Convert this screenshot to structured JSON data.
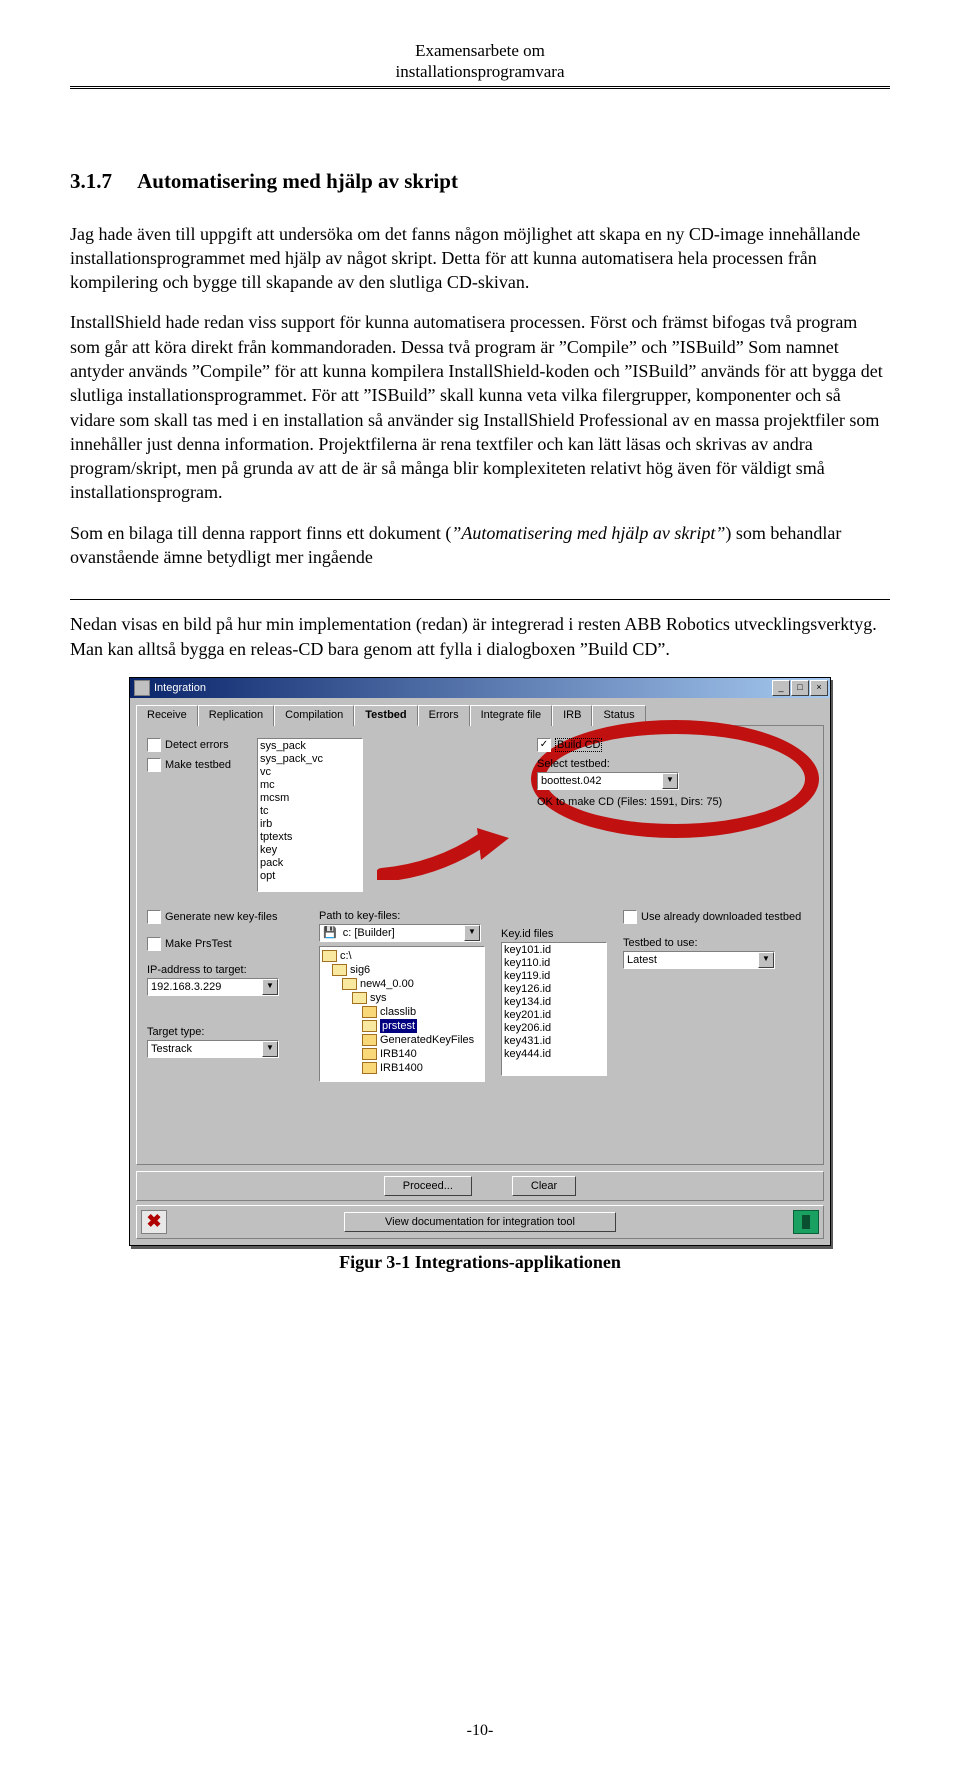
{
  "header": {
    "line1": "Examensarbete om",
    "line2": "installationsprogramvara"
  },
  "section": {
    "number": "3.1.7",
    "title": "Automatisering med hjälp av skript"
  },
  "para1": "Jag hade även till uppgift att undersöka om det fanns någon möjlighet att skapa en ny CD-image innehållande installationsprogrammet med hjälp av något skript. Detta för att kunna automatisera hela processen från kompilering och bygge till skapande av den slutliga CD-skivan.",
  "para2": "InstallShield hade redan viss support för kunna automatisera processen. Först och främst bifogas två program som går att köra direkt från kommandoraden. Dessa två program är ”Compile” och ”ISBuild” Som namnet antyder används ”Compile” för att kunna kompilera InstallShield-koden och ”ISBuild” används för att bygga det slutliga installationsprogrammet. För att ”ISBuild” skall kunna veta vilka filergrupper, komponenter och så vidare som skall tas med i en installation så använder sig InstallShield Professional av en massa projektfiler som innehåller just denna information. Projektfilerna är rena textfiler och kan lätt läsas och skrivas av andra program/skript, men på grunda av att de är så många blir komplexiteten relativt hög även för väldigt små installationsprogram.",
  "para3a": "Som en bilaga till denna rapport finns ett dokument (",
  "para3i": "”Automatisering med hjälp av skript”",
  "para3b": ") som behandlar ovanstående ämne betydligt mer ingående",
  "para4": "Nedan visas en bild på hur min implementation (redan) är integrerad i resten ABB Robotics utvecklingsverktyg. Man kan alltså bygga en releas-CD bara genom att fylla i dialogboxen ”Build CD”.",
  "figure_caption": "Figur 3-1 Integrations-applikationen",
  "page_number": "-10-",
  "win": {
    "title": "Integration",
    "tabs": [
      "Receive",
      "Replication",
      "Compilation",
      "Testbed",
      "Errors",
      "Integrate file",
      "IRB",
      "Status"
    ],
    "active_tab": "Testbed",
    "cb_detect": "Detect errors",
    "cb_make_testbed": "Make testbed",
    "list_left": [
      "sys_pack",
      "sys_pack_vc",
      "vc",
      "mc",
      "mcsm",
      "tc",
      "irb",
      "tptexts",
      "key",
      "pack",
      "opt"
    ],
    "cb_build_cd": "Build CD",
    "lbl_select_testbed": "Select testbed:",
    "combo_boottest": "boottest.042",
    "ok_make_cd": "OK to make CD (Files: 1591, Dirs: 75)",
    "cb_gen_keys": "Generate new key-files",
    "cb_make_prstest": "Make PrsTest",
    "lbl_ip": "IP-address to target:",
    "combo_ip": "192.168.3.229",
    "lbl_target_type": "Target type:",
    "combo_target": "Testrack",
    "lbl_path_key": "Path to key-files:",
    "combo_drive": "c: [Builder]",
    "tree": [
      {
        "name": "c:\\",
        "indent": 0,
        "open": true
      },
      {
        "name": "sig6",
        "indent": 1,
        "open": true
      },
      {
        "name": "new4_0.00",
        "indent": 2,
        "open": true
      },
      {
        "name": "sys",
        "indent": 3,
        "open": true
      },
      {
        "name": "classlib",
        "indent": 4,
        "open": false
      },
      {
        "name": "prstest",
        "indent": 4,
        "open": false,
        "selected": true
      },
      {
        "name": "GeneratedKeyFiles",
        "indent": 4,
        "open": false
      },
      {
        "name": "IRB140",
        "indent": 4,
        "open": false
      },
      {
        "name": "IRB1400",
        "indent": 4,
        "open": false
      }
    ],
    "lbl_keyid": "Key.id files",
    "list_key": [
      "key101.id",
      "key110.id",
      "key119.id",
      "key126.id",
      "key134.id",
      "key201.id",
      "key206.id",
      "key431.id",
      "key444.id"
    ],
    "cb_use_dl": "Use already downloaded  testbed",
    "lbl_testbed_use": "Testbed to use:",
    "combo_testbed_use": "Latest",
    "btn_proceed": "Proceed...",
    "btn_clear": "Clear",
    "btn_viewdoc": "View documentation for integration tool"
  }
}
